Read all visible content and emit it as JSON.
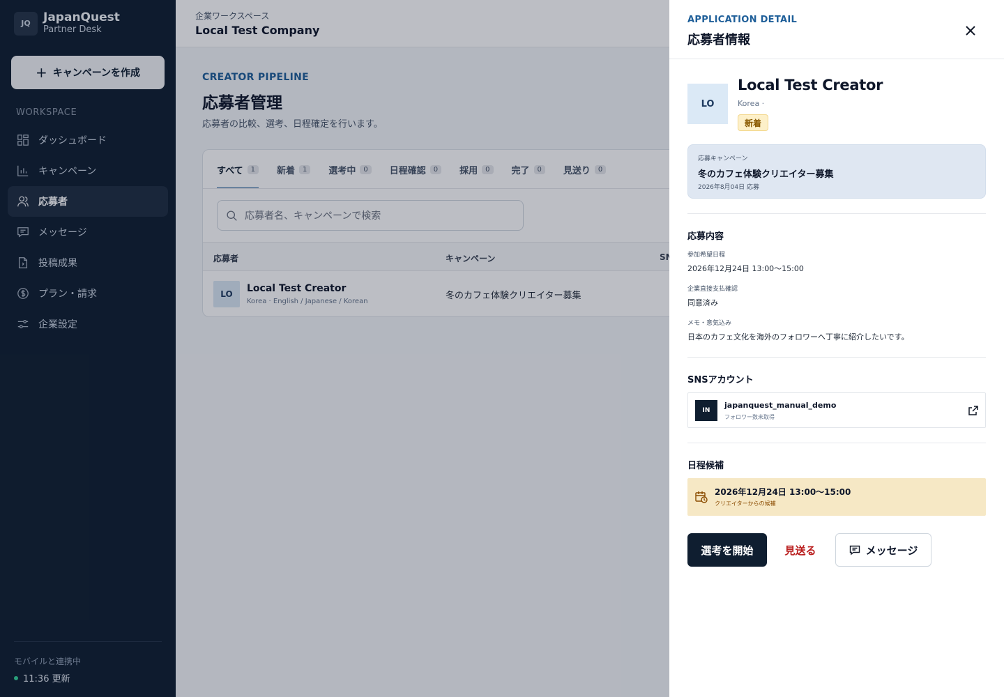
{
  "sidebar": {
    "logo": "JQ",
    "brand": "JapanQuest",
    "subtitle": "Partner Desk",
    "create_label": "キャンペーンを作成",
    "section": "WORKSPACE",
    "items": [
      {
        "label": "ダッシュボード",
        "icon": "dashboard-icon"
      },
      {
        "label": "キャンペーン",
        "icon": "bar-chart-icon"
      },
      {
        "label": "応募者",
        "icon": "users-icon",
        "active": true
      },
      {
        "label": "メッセージ",
        "icon": "message-icon"
      },
      {
        "label": "投稿成果",
        "icon": "document-icon"
      },
      {
        "label": "プラン・請求",
        "icon": "dollar-icon"
      },
      {
        "label": "企業設定",
        "icon": "settings-sliders-icon"
      }
    ],
    "sync_label": "モバイルと連携中",
    "sync_time": "11:36 更新"
  },
  "topbar": {
    "caption": "企業ワークスペース",
    "company": "Local Test Company"
  },
  "page": {
    "eyebrow": "CREATOR PIPELINE",
    "title": "応募者管理",
    "description": "応募者の比較、選考、日程確定を行います。",
    "tabs": [
      {
        "label": "すべて",
        "count": "1"
      },
      {
        "label": "新着",
        "count": "1"
      },
      {
        "label": "選考中",
        "count": "0"
      },
      {
        "label": "日程確認",
        "count": "0"
      },
      {
        "label": "採用",
        "count": "0"
      },
      {
        "label": "完了",
        "count": "0"
      },
      {
        "label": "見送り",
        "count": "0"
      }
    ],
    "search_placeholder": "応募者名、キャンペーンで検索",
    "columns": [
      "応募者",
      "キャンペーン",
      "SNS"
    ],
    "rows": [
      {
        "avatar": "LO",
        "name": "Local Test Creator",
        "languages": "Korea · English / Japanese / Korean",
        "campaign": "冬のカフェ体験クリエイター募集"
      }
    ]
  },
  "drawer": {
    "eyebrow": "APPLICATION DETAIL",
    "title": "応募者情報",
    "avatar": "LO",
    "name": "Local Test Creator",
    "country": "Korea ·",
    "badge": "新着",
    "campaign_label": "応募キャンペーン",
    "campaign_name": "冬のカフェ体験クリエイター募集",
    "campaign_date": "2026年8月04日 応募",
    "content_title": "応募内容",
    "fields": [
      {
        "label": "参加希望日程",
        "value": "2026年12月24日 13:00〜15:00"
      },
      {
        "label": "企業直接支払確認",
        "value": "同意済み"
      },
      {
        "label": "メモ・意気込み",
        "value": "日本のカフェ文化を海外のフォロワーへ丁寧に紹介したいです。"
      }
    ],
    "sns_title": "SNSアカウント",
    "sns_icon": "IN",
    "sns_handle": "japanquest_manual_demo",
    "sns_followers": "フォロワー数未取得",
    "schedule_title": "日程候補",
    "slot_time": "2026年12月24日 13:00〜15:00",
    "slot_source": "クリエイターからの候補",
    "start_label": "選考を開始",
    "reject_label": "見送る",
    "message_label": "メッセージ"
  },
  "colors": {
    "sidebar_bg": "#0f1e30",
    "accent": "#1f5f99",
    "danger": "#b91c1c",
    "badge_new": "#fdf0c9",
    "slot_bg": "#f6e8c5"
  }
}
